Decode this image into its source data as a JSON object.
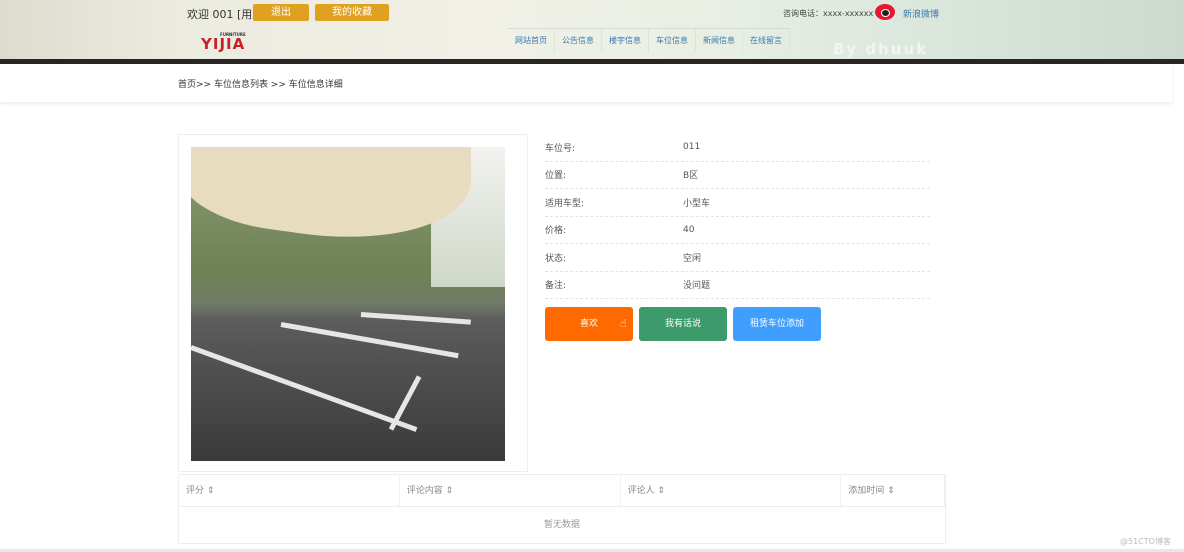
{
  "header": {
    "welcome": "欢迎 001 [用户]",
    "logout": "退出",
    "favorites": "我的收藏",
    "phone": "咨询电话：xxxx-xxxxxx",
    "weibo": "新浪微博",
    "logo": "YIJIA",
    "logo_sub": "FURNITURE",
    "watermark": "By dhuuk No.20210322103903242072",
    "nav": [
      "网站首页",
      "公告信息",
      "楼宇信息",
      "车位信息",
      "新闻信息",
      "在线留言"
    ]
  },
  "breadcrumb": "首页>> 车位信息列表 >> 车位信息详细",
  "details": [
    {
      "label": "车位号:",
      "value": "011"
    },
    {
      "label": "位置:",
      "value": "B区"
    },
    {
      "label": "适用车型:",
      "value": "小型车"
    },
    {
      "label": "价格:",
      "value": "40"
    },
    {
      "label": "状态:",
      "value": "空闲"
    },
    {
      "label": "备注:",
      "value": "没问题"
    }
  ],
  "buttons": {
    "like": "喜欢",
    "comment": "我有话说",
    "rent": "租赁车位添加"
  },
  "colors": {
    "like": "#ff6a00",
    "comment": "#3c9a6b",
    "rent": "#409eff",
    "header_button": "#e0a020"
  },
  "table": {
    "columns": [
      "评分",
      "评论内容",
      "评论人",
      "添加时间"
    ],
    "sort_icon": "⇕",
    "empty": "暂无数据"
  },
  "credit": "@51CTO博客"
}
